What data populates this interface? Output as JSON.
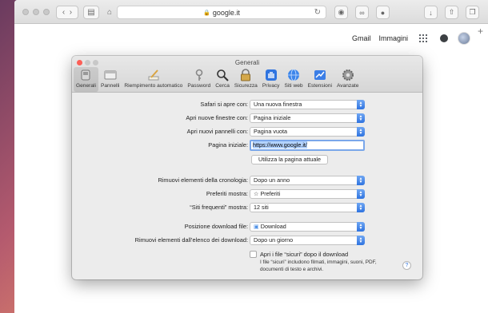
{
  "browser": {
    "address": "google.it",
    "colors": {
      "traffic_gray": "#c9c9c9",
      "accent": "#2f74e0"
    }
  },
  "google_bar": {
    "gmail": "Gmail",
    "images": "Immagini"
  },
  "prefs": {
    "title": "Generali",
    "tabs": [
      {
        "label": "Generali",
        "icon": "switch-icon"
      },
      {
        "label": "Pannelli",
        "icon": "tabs-icon"
      },
      {
        "label": "Riempimento automatico",
        "icon": "pencil-icon"
      },
      {
        "label": "Password",
        "icon": "key-icon"
      },
      {
        "label": "Cerca",
        "icon": "magnifier-icon"
      },
      {
        "label": "Sicurezza",
        "icon": "padlock-icon"
      },
      {
        "label": "Privacy",
        "icon": "hand-icon"
      },
      {
        "label": "Siti web",
        "icon": "globe-icon"
      },
      {
        "label": "Estensioni",
        "icon": "puzzle-icon"
      },
      {
        "label": "Avanzate",
        "icon": "gear-icon"
      }
    ],
    "rows": {
      "safari_opens_label": "Safari si apre con:",
      "safari_opens_value": "Una nuova finestra",
      "new_windows_label": "Apri nuove finestre con:",
      "new_windows_value": "Pagina iniziale",
      "new_tabs_label": "Apri nuovi pannelli con:",
      "new_tabs_value": "Pagina vuota",
      "homepage_label": "Pagina iniziale:",
      "homepage_value": "https://www.google.it/",
      "use_current_button": "Utilizza la pagina attuale",
      "remove_history_label": "Rimuovi elementi della cronologia:",
      "remove_history_value": "Dopo un anno",
      "favorites_label": "Preferiti mostra:",
      "favorites_value": "Preferiti",
      "top_sites_label": "“Siti frequenti” mostra:",
      "top_sites_value": "12 siti",
      "download_location_label": "Posizione download file:",
      "download_location_value": "Download",
      "remove_downloads_label": "Rimuovi elementi dall’elenco dei download:",
      "remove_downloads_value": "Dopo un giorno",
      "open_safe_files_label": "Apri i file “sicuri” dopo il download",
      "open_safe_files_note": "I file “sicuri” includono filmati, immagini, suoni, PDF, documenti di testo e archivi."
    },
    "help": "?"
  }
}
